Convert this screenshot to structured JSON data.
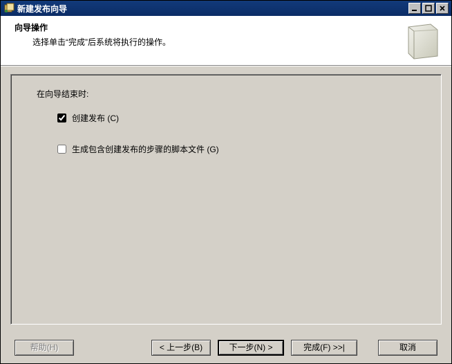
{
  "window": {
    "title": "新建发布向导"
  },
  "header": {
    "title": "向导操作",
    "subtitle": "选择单击“完成”后系统将执行的操作。"
  },
  "body": {
    "intro": "在向导结束时:",
    "option1_label": "创建发布 (C)",
    "option1_checked": true,
    "option2_label": "生成包含创建发布的步骤的脚本文件 (G)",
    "option2_checked": false
  },
  "buttons": {
    "help": "帮助(H)",
    "back": "< 上一步(B)",
    "next": "下一步(N) >",
    "finish": "完成(F) >>|",
    "cancel": "取消"
  }
}
